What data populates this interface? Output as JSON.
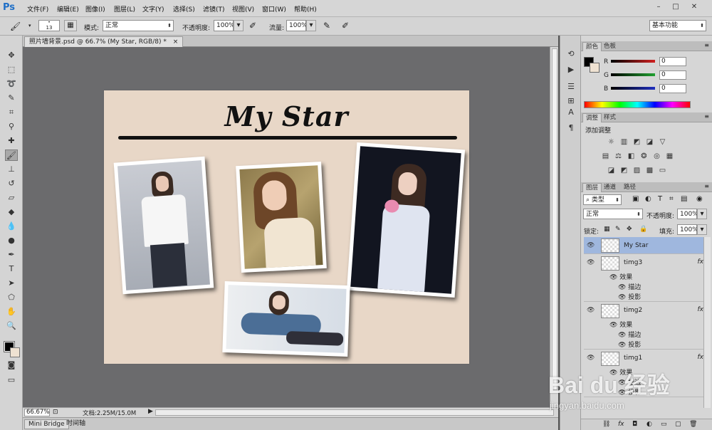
{
  "app": {
    "logo": "Ps",
    "workspace": "基本功能"
  },
  "menu": [
    "文件(F)",
    "编辑(E)",
    "图像(I)",
    "图层(L)",
    "文字(Y)",
    "选择(S)",
    "滤镜(T)",
    "视图(V)",
    "窗口(W)",
    "帮助(H)"
  ],
  "window_controls": {
    "minimize": "–",
    "restore": "□",
    "close": "✕"
  },
  "options": {
    "brush_size": "13",
    "mode_label": "模式:",
    "mode_value": "正常",
    "opacity_label": "不透明度:",
    "opacity_value": "100%",
    "flow_label": "流量:",
    "flow_value": "100%"
  },
  "document": {
    "tab_title": "照片墙背景.psd @ 66.7% (My Star, RGB/8) *",
    "tab_close": "×",
    "artboard_title": "My Star"
  },
  "status": {
    "zoom": "66.67%",
    "doc_info": "文档:2.25M/15.0M"
  },
  "bottom_tabs": [
    "Mini Bridge",
    "时间轴"
  ],
  "color_panel": {
    "tabs": [
      "颜色",
      "色板"
    ],
    "channels": [
      {
        "label": "R",
        "value": "0",
        "color": "#d02020"
      },
      {
        "label": "G",
        "value": "0",
        "color": "#20a030"
      },
      {
        "label": "B",
        "value": "0",
        "color": "#2030c0"
      }
    ]
  },
  "adjust_panel": {
    "tabs": [
      "调整",
      "样式"
    ],
    "title": "添加调整"
  },
  "layers_panel": {
    "tabs": [
      "图层",
      "通道",
      "路径"
    ],
    "filter_kind": "类型",
    "blend_mode": "正常",
    "opacity_label": "不透明度:",
    "opacity_value": "100%",
    "lock_label": "锁定:",
    "fill_label": "填充:",
    "fill_value": "100%",
    "layers": [
      {
        "name": "My Star",
        "selected": true,
        "has_fx": false
      },
      {
        "name": "timg3",
        "selected": false,
        "has_fx": true
      },
      {
        "name": "timg2",
        "selected": false,
        "has_fx": true
      },
      {
        "name": "timg1",
        "selected": false,
        "has_fx": true
      }
    ],
    "effects_label": "效果",
    "stroke_label": "描边",
    "shadow_label": "投影",
    "fx_label": "fx"
  },
  "watermark": {
    "brand": "Bai du 经验",
    "url": "jingyan.baidu.com"
  }
}
